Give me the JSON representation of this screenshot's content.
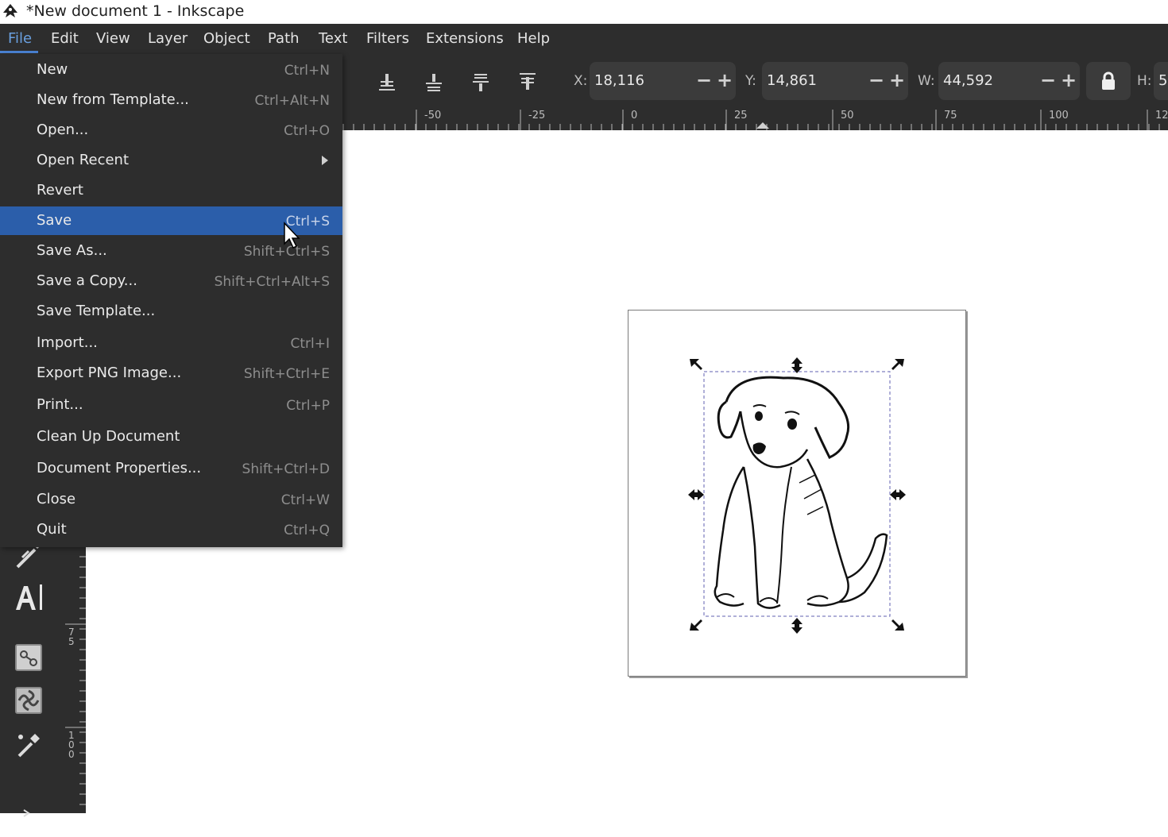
{
  "window": {
    "title": "*New document 1 - Inkscape",
    "app_icon": "inkscape-icon"
  },
  "menubar": {
    "items": [
      {
        "label": "File"
      },
      {
        "label": "Edit"
      },
      {
        "label": "View"
      },
      {
        "label": "Layer"
      },
      {
        "label": "Object"
      },
      {
        "label": "Path"
      },
      {
        "label": "Text"
      },
      {
        "label": "Filters"
      },
      {
        "label": "Extensions"
      },
      {
        "label": "Help"
      }
    ],
    "active": "File"
  },
  "toolbar": {
    "x_label": "X:",
    "x_value": "18,116",
    "y_label": "Y:",
    "y_value": "14,861",
    "w_label": "W:",
    "w_value": "44,592",
    "h_label": "H:",
    "h_value": "5",
    "minus": "−",
    "plus": "+",
    "align_icons": [
      "align-bottom-icon",
      "align-bottom-inner-icon",
      "align-top-inner-icon",
      "align-top-icon"
    ],
    "lock_icon": "lock-icon"
  },
  "ruler": {
    "h_labels": [
      "-50",
      "-25",
      "0",
      "25",
      "50",
      "75",
      "100",
      "12"
    ],
    "v_labels": [
      "7 5",
      "1 0 0"
    ]
  },
  "tools": [
    "calligraphy-icon",
    "text-tool-icon",
    "connector-icon",
    "tweak-icon",
    "dropper-icon"
  ],
  "file_menu": {
    "items": [
      {
        "label": "New",
        "shortcut": "Ctrl+N"
      },
      {
        "label": "New from Template...",
        "shortcut": "Ctrl+Alt+N"
      },
      {
        "label": "Open...",
        "shortcut": "Ctrl+O"
      },
      {
        "label": "Open Recent",
        "shortcut": ""
      },
      {
        "label": "Revert",
        "shortcut": ""
      },
      {
        "label": "Save",
        "shortcut": "Ctrl+S"
      },
      {
        "label": "Save As...",
        "shortcut": "Shift+Ctrl+S"
      },
      {
        "label": "Save a Copy...",
        "shortcut": "Shift+Ctrl+Alt+S"
      },
      {
        "label": "Save Template...",
        "shortcut": ""
      },
      {
        "label": "Import...",
        "shortcut": "Ctrl+I"
      },
      {
        "label": "Export PNG Image...",
        "shortcut": "Shift+Ctrl+E"
      },
      {
        "label": "Print...",
        "shortcut": "Ctrl+P"
      },
      {
        "label": "Clean Up Document",
        "shortcut": ""
      },
      {
        "label": "Document Properties...",
        "shortcut": "Shift+Ctrl+D"
      },
      {
        "label": "Close",
        "shortcut": "Ctrl+W"
      },
      {
        "label": "Quit",
        "shortcut": "Ctrl+Q"
      }
    ],
    "highlighted": "Save",
    "submenu_item": "Open Recent"
  },
  "colors": {
    "panel": "#2d2d2d",
    "highlight": "#2b5eaa",
    "accent": "#4a83d4"
  }
}
